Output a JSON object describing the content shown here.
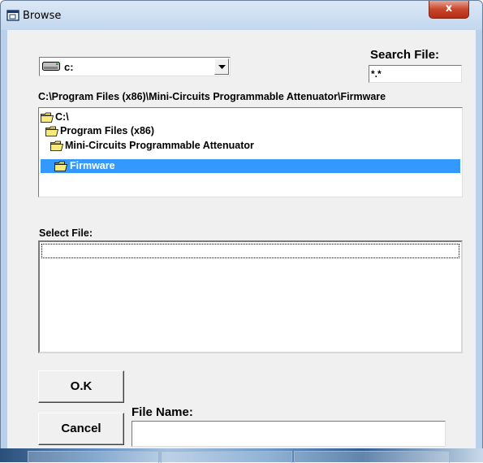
{
  "window": {
    "title": "Browse",
    "close_label": "x"
  },
  "drive": {
    "selected": "c:",
    "icon": "drive-icon"
  },
  "search": {
    "label": "Search File:",
    "value": "*.*"
  },
  "current_path": "C:\\Program Files (x86)\\Mini-Circuits Programmable Attenuator\\Firmware",
  "directories": [
    {
      "label": "C:\\",
      "icon": "open-folder-icon",
      "selected": false
    },
    {
      "label": "Program Files (x86)",
      "icon": "open-folder-icon",
      "selected": false
    },
    {
      "label": "Mini-Circuits Programmable Attenuator",
      "icon": "open-folder-icon",
      "selected": false
    },
    {
      "label": "Firmware",
      "icon": "open-folder-icon",
      "selected": true
    }
  ],
  "select_file": {
    "label": "Select File:",
    "items": []
  },
  "buttons": {
    "ok": "O.K",
    "cancel": "Cancel"
  },
  "file_name": {
    "label": "File Name:",
    "value": ""
  },
  "colors": {
    "selection": "#3399ff",
    "window_bg": "#f0f0f0",
    "frame": "#b9d1ea",
    "close": "#c7462c"
  }
}
